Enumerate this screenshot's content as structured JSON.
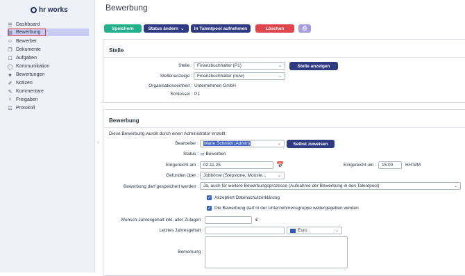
{
  "sidebar": {
    "logo": "hr works",
    "items": [
      {
        "label": "Dashboard",
        "icon": "dashboard-icon",
        "glyph": "☰"
      },
      {
        "label": "Bewerbung",
        "icon": "application-icon",
        "glyph": "▤"
      },
      {
        "label": "Bewerber",
        "icon": "person-icon",
        "glyph": "☺"
      },
      {
        "label": "Dokumente",
        "icon": "documents-icon",
        "glyph": "❐"
      },
      {
        "label": "Aufgaben",
        "icon": "tasks-icon",
        "glyph": "☐"
      },
      {
        "label": "Kommunikation",
        "icon": "chat-icon",
        "glyph": "◯"
      },
      {
        "label": "Bewertungen",
        "icon": "star-icon",
        "glyph": "★"
      },
      {
        "label": "Notizen",
        "icon": "pin-icon",
        "glyph": "✐"
      },
      {
        "label": "Kommentare",
        "icon": "comment-icon",
        "glyph": "✎"
      },
      {
        "label": "Freigaben",
        "icon": "share-icon",
        "glyph": "⑂"
      },
      {
        "label": "Protokoll",
        "icon": "log-icon",
        "glyph": "☷"
      }
    ],
    "collapse_glyph": "‹"
  },
  "page": {
    "title": "Bewerbung"
  },
  "toolbar": {
    "save": "Speichern",
    "status": "Status ändern",
    "talentpool": "In Talentpool aufnehmen",
    "delete": "Löschen",
    "print_icon": "⎙",
    "chevron": "⌄"
  },
  "colors": {
    "green": "#23b08a",
    "navy": "#2f3a84",
    "red": "#e0474c",
    "lavender": "#a89ce0"
  },
  "stelle": {
    "heading": "Stelle",
    "stelle_label": "Stelle :",
    "stelle_value": "Finanzbuchhalter (P1)",
    "show_button": "Stelle anzeigen",
    "anzeige_label": "Stellenanzeige :",
    "anzeige_value": "Finanzbuchhalter (m/w)",
    "org_label": "Organisationseinheit :",
    "org_value": "Unternehmen GmbH",
    "key_label": "Schlüssel :",
    "key_value": "P1"
  },
  "bewerbung": {
    "heading": "Bewerbung",
    "note": "Diese Bewerbung wurde durch einen Administrator erstellt",
    "editor_label": "Bearbeiter :",
    "editor_value": "Marie Schmidt (Admin)",
    "assign_button": "Selbst zuweisen",
    "status_label": "Status :",
    "status_value": "Beworben",
    "date_label": "Eingereicht am :",
    "date_value": "02.11.25",
    "time_label": "Eingereicht um :",
    "time_value": "15:00",
    "time_format": "HH:MM",
    "found_label": "Gefunden über :",
    "found_value": "Jobbörse (Stepstone, Monste...",
    "store_label": "Bewerbung darf gespeichert werden :",
    "store_value": "Ja, auch für weitere Bewerbungsprozesse (Aufnahme der Bewerbung in den Talentpool)",
    "privacy_label": "Akzeptiert Datenschutzerklärung",
    "forward_label": "Die Bewerbung darf in der Unternehmensgruppe weitergegeben werden",
    "salary_label": "Wunsch-Jahresgehalt inkl. aller Zulagen :",
    "currency_symbol": "€",
    "last_salary_label": "Letztes Jahresgehalt :",
    "currency_value": "Euro",
    "remark_label": "Bemerkung :"
  }
}
